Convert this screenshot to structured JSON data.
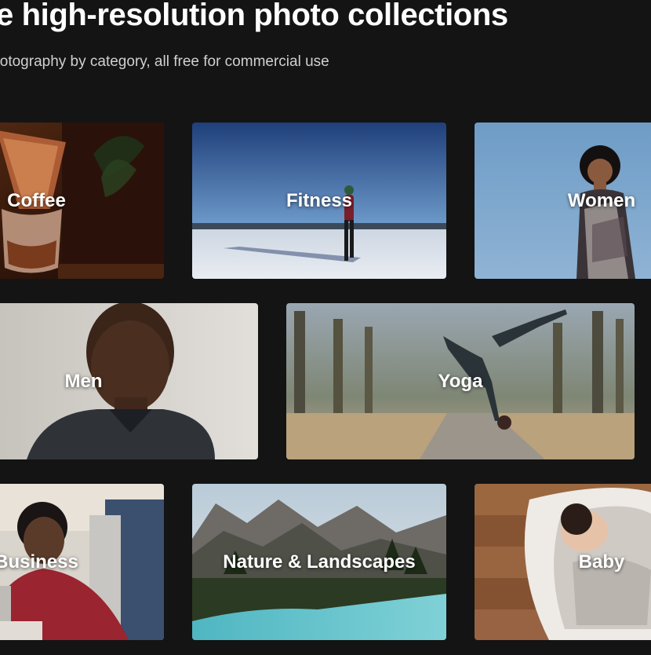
{
  "hero": {
    "title": "Free high-resolution photo collections",
    "subtitle": "Browse photography by category, all free for commercial use"
  },
  "collections": [
    {
      "label": "Coffee",
      "image": "coffee-photo"
    },
    {
      "label": "Fitness",
      "image": "fitness-photo"
    },
    {
      "label": "Women",
      "image": "women-photo"
    },
    {
      "label": "Men",
      "image": "men-photo"
    },
    {
      "label": "Yoga",
      "image": "yoga-photo"
    },
    {
      "label": "Business",
      "image": "business-photo"
    },
    {
      "label": "Nature & Landscapes",
      "image": "nature-photo"
    },
    {
      "label": "Baby",
      "image": "baby-photo"
    }
  ],
  "colors": {
    "background": "#141414",
    "title_text": "#ffffff",
    "subtitle_text": "#d0d0d0",
    "card_label": "#ffffff"
  }
}
